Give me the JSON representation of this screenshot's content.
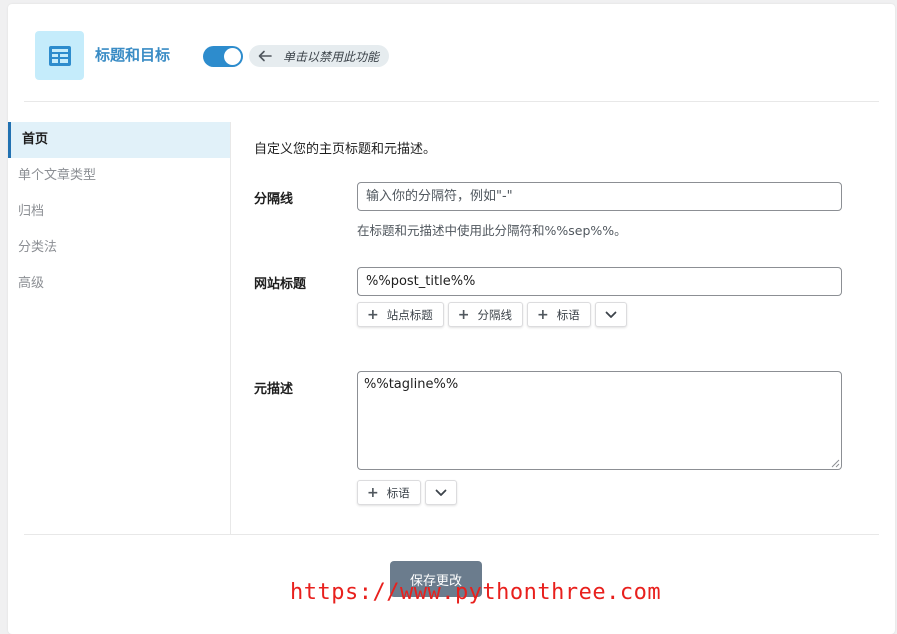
{
  "header": {
    "module_icon": "table-icon",
    "title": "标题和目标",
    "toggle_on": true,
    "toggle_hint": "单击以禁用此功能",
    "hint_icon": "arrow-left-icon"
  },
  "sidebar": {
    "items": [
      {
        "label": "首页",
        "active": true
      },
      {
        "label": "单个文章类型",
        "active": false
      },
      {
        "label": "归档",
        "active": false
      },
      {
        "label": "分类法",
        "active": false
      },
      {
        "label": "高级",
        "active": false
      }
    ]
  },
  "main": {
    "intro": "自定义您的主页标题和元描述。",
    "separator": {
      "label": "分隔线",
      "placeholder": "输入你的分隔符，例如\"-\"",
      "value": "",
      "help": "在标题和元描述中使用此分隔符和%%sep%%。"
    },
    "site_title": {
      "label": "网站标题",
      "value": "%%post_title%%",
      "buttons": [
        "站点标题",
        "分隔线",
        "标语"
      ]
    },
    "meta_description": {
      "label": "元描述",
      "value": "%%tagline%%",
      "buttons": [
        "标语"
      ]
    }
  },
  "footer": {
    "save_label": "保存更改"
  },
  "watermark": "https://www.pythonthree.com",
  "colors": {
    "accent": "#2271b1",
    "toggle": "#2d8ccd",
    "icon_bg": "#c5ecfb",
    "save_button": "#6b7c8d",
    "watermark": "#e8201d"
  }
}
